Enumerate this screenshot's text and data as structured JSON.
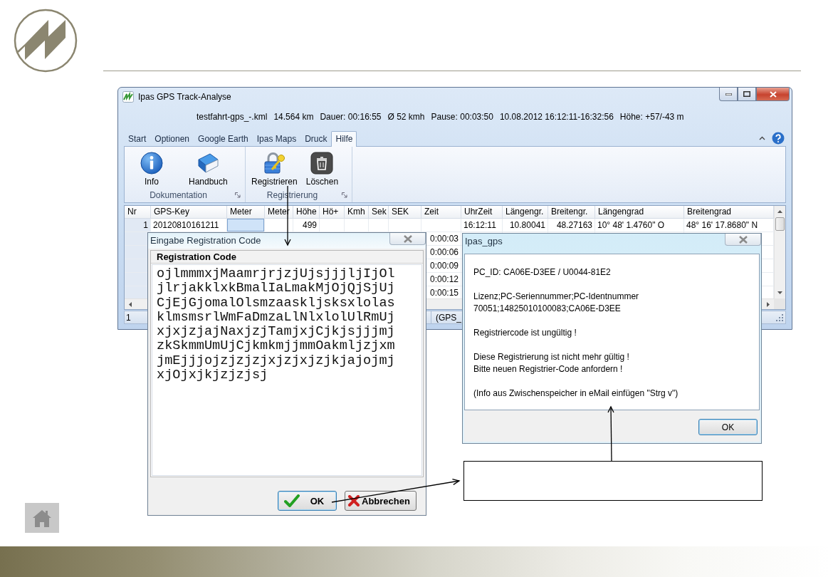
{
  "app_window": {
    "title": "Ipas GPS Track-Analyse",
    "track_info": [
      "testfahrt-gps_-.kml",
      "14.564 km",
      "Dauer: 00:16:55",
      "Ø 52 kmh",
      "Pause: 00:03:50",
      "10.08.2012 16:12:11-16:32:56",
      "Höhe: +57/-43 m"
    ],
    "tabs": [
      {
        "label": "Start",
        "selected": false
      },
      {
        "label": "Optionen",
        "selected": false
      },
      {
        "label": "Google Earth",
        "selected": false
      },
      {
        "label": "Ipas Maps",
        "selected": false
      },
      {
        "label": "Druck",
        "selected": false
      },
      {
        "label": "Hilfe",
        "selected": true
      }
    ],
    "ribbon_groups": [
      {
        "label": "Dokumentation",
        "buttons": [
          "Info",
          "Handbuch"
        ]
      },
      {
        "label": "Registrierung",
        "buttons": [
          "Registrieren",
          "Löschen"
        ]
      }
    ],
    "table": {
      "columns": [
        "Nr",
        "GPS-Key",
        "Meter",
        "Meter",
        "Höhe",
        "Hö+",
        "Kmh",
        "Sek",
        "SEK",
        "Zeit",
        "UhrZeit",
        "Längengr.",
        "Breitengr.",
        "Längengrad",
        "Breitengrad"
      ],
      "rows": [
        {
          "nr": "1",
          "gps_key": "20120810161211",
          "meter_selected": true,
          "hoehe": "499",
          "uhrzeit": "16:12:11",
          "laengengr": "10.80041",
          "breitengr": "48.27163",
          "laengengrad": "10° 48' 1.4760\" O",
          "breitengrad": "48° 16' 17.8680\" N"
        },
        {
          "zeit": "0:00:03"
        },
        {
          "zeit": "0:00:06"
        },
        {
          "zeit": "0:00:09"
        },
        {
          "zeit": "0:00:12"
        },
        {
          "zeit": "0:00:15"
        }
      ]
    },
    "status_bar": [
      "1",
      "(GPS_"
    ]
  },
  "registration_dialog": {
    "title": "Eingabe Registration Code",
    "group_label": "Registration Code",
    "code": "ojlmmmxjMaamrjrjzjUjsjjjljIjOljlrjakklxkBmalIaLmakMjOjQjSjUjCjEjGjomalOlsmzaaskljsksxlolasklmsmsrlWmFaDmzaLlNlxlolUlRmUjxjxjzjajNaxjzjTamjxjCjkjsjjjmjzkSkmmUmUjCjkmkmjjmmOakmljzjxmjmEjjjojzjzjzjxjzjxjzjkjajojmjxjOjxjkjzjzjsj",
    "buttons": [
      {
        "label": "OK",
        "focused": true
      },
      {
        "label": "Abbrechen",
        "focused": false
      }
    ]
  },
  "message_dialog": {
    "title": "Ipas_gps",
    "paragraphs": [
      [
        "PC_ID: CA06E-D3EE / U0044-81E2"
      ],
      [
        "Lizenz;PC-Seriennummer;PC-Identnummer",
        "70051;14825010100083;CA06E-D3EE"
      ],
      [
        "Registriercode ist ungültig !"
      ],
      [
        "Diese Registrierung ist nicht mehr gültig !",
        "Bitte neuen Registrier-Code anfordern !"
      ],
      [
        "(Info aus Zwischenspeicher in eMail einfügen \"Strg v\")"
      ]
    ],
    "buttons": [
      {
        "label": "OK",
        "focused": true
      }
    ]
  }
}
